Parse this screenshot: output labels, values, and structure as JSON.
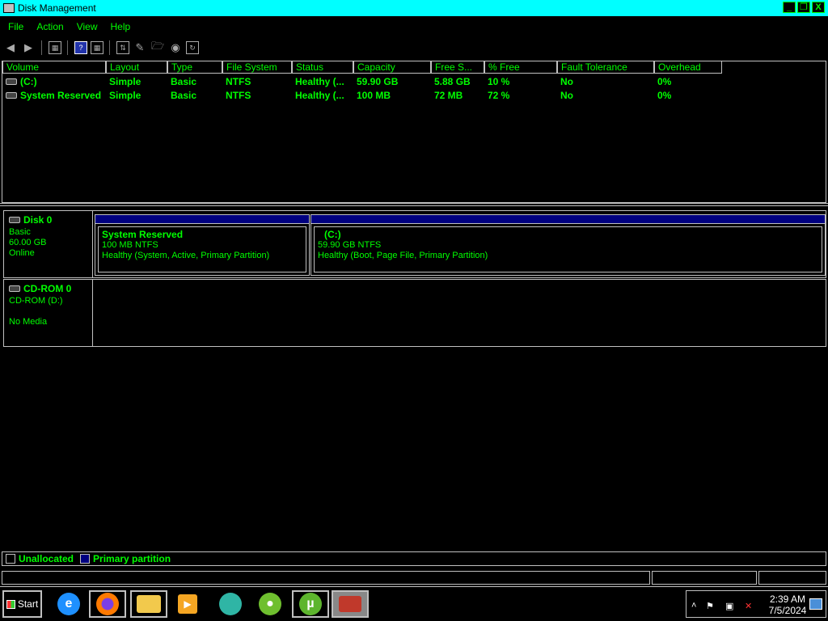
{
  "window": {
    "title": "Disk Management",
    "controls": [
      "_",
      "❐",
      "X"
    ]
  },
  "menu": [
    "File",
    "Action",
    "View",
    "Help"
  ],
  "volume_table": {
    "columns": [
      "Volume",
      "Layout",
      "Type",
      "File System",
      "Status",
      "Capacity",
      "Free S...",
      "% Free",
      "Fault Tolerance",
      "Overhead"
    ],
    "rows": [
      [
        "(C:)",
        "Simple",
        "Basic",
        "NTFS",
        "Healthy (...",
        "59.90 GB",
        "5.88 GB",
        "10 %",
        "No",
        "0%"
      ],
      [
        "System Reserved",
        "Simple",
        "Basic",
        "NTFS",
        "Healthy (...",
        "100 MB",
        "72 MB",
        "72 %",
        "No",
        "0%"
      ]
    ]
  },
  "disks": {
    "disk0": {
      "name": "Disk 0",
      "type": "Basic",
      "size": "60.00 GB",
      "status": "Online",
      "partitions": [
        {
          "name": "System Reserved",
          "size": "100 MB NTFS",
          "status": "Healthy (System, Active, Primary Partition)"
        },
        {
          "name": "(C:)",
          "size": "59.90 GB NTFS",
          "status": "Healthy (Boot, Page File, Primary Partition)"
        }
      ]
    },
    "cdrom0": {
      "name": "CD-ROM 0",
      "drive": "CD-ROM (D:)",
      "media": "No Media"
    }
  },
  "legend": {
    "unallocated": "Unallocated",
    "primary": "Primary partition"
  },
  "taskbar": {
    "start": "Start",
    "apps": [
      "internet-explorer-icon",
      "firefox-icon",
      "file-explorer-icon",
      "media-player-icon",
      "browser-icon",
      "coccoc-icon",
      "utorrent-icon",
      "toolbox-icon"
    ],
    "time": "2:39 AM",
    "date": "7/5/2024"
  },
  "colors": {
    "text": "#00ff00",
    "title_bar": "#00ffff",
    "primary_partition": "#000080",
    "background": "#000000"
  }
}
